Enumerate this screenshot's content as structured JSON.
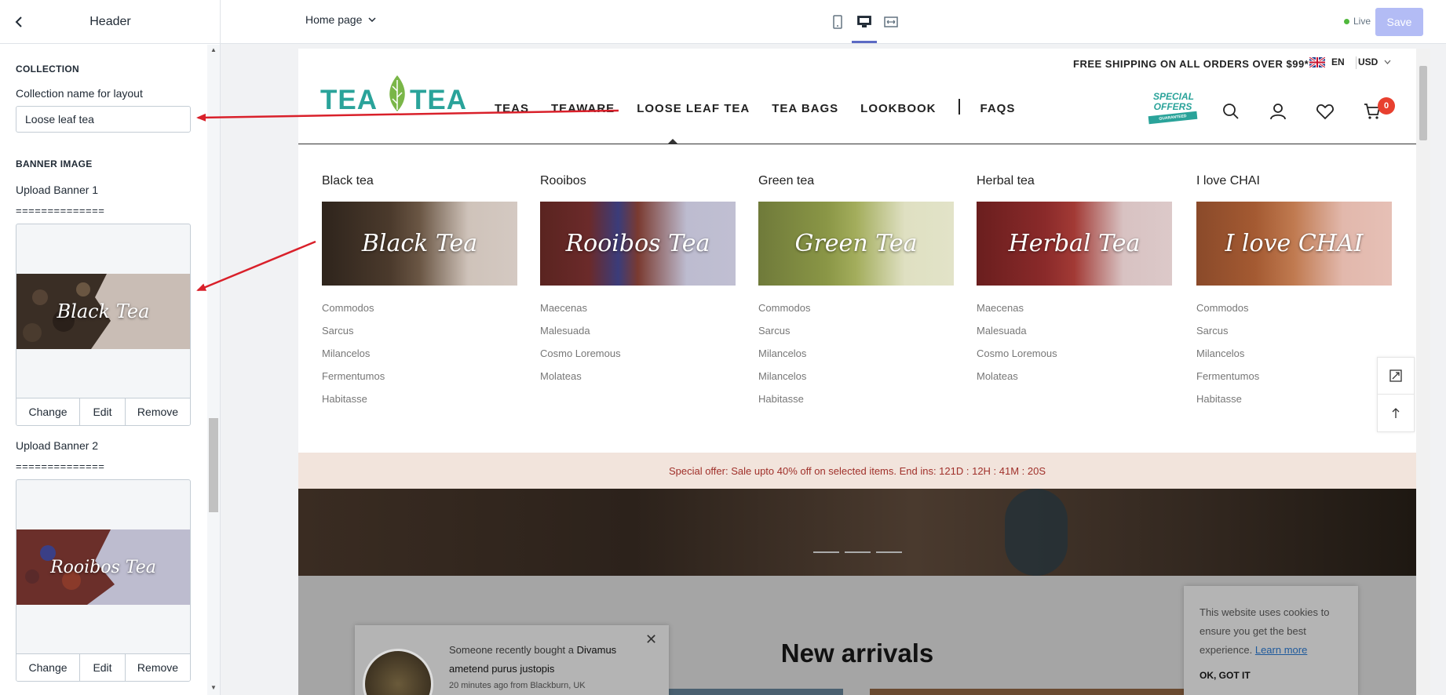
{
  "sidebar": {
    "title": "Header",
    "collection_section": "COLLECTION",
    "collection_label": "Collection name for layout",
    "collection_value": "Loose leaf tea",
    "banner_section": "BANNER IMAGE",
    "upload1_label": "Upload Banner 1",
    "upload2_label": "Upload Banner 2",
    "separator": "==============",
    "upload1_image_text": "Black Tea",
    "upload2_image_text": "Rooibos Tea",
    "actions": {
      "change": "Change",
      "edit": "Edit",
      "remove": "Remove"
    }
  },
  "topbar": {
    "page_select": "Home page",
    "status": "Live",
    "save_label": "Save",
    "accent_color": "#5c6ac4",
    "live_color": "#50b83c"
  },
  "store": {
    "shipping_text": "FREE SHIPPING ON ALL ORDERS OVER $99*",
    "language": "EN",
    "currency": "USD",
    "logo_left": "TEA",
    "logo_right": "TEA",
    "badge_line1": "SPECIAL",
    "badge_line2": "OFFERS",
    "badge_ribbon": "GUARANTEED",
    "nav": [
      "TEAS",
      "TEAWARE",
      "LOOSE LEAF TEA",
      "TEA BAGS",
      "LOOKBOOK",
      "FAQS"
    ],
    "cart_count": "0",
    "mega_menu": [
      {
        "title": "Black tea",
        "image_text": "Black Tea",
        "links": [
          "Commodos",
          "Sarcus",
          "Milancelos",
          "Fermentumos",
          "Habitasse"
        ]
      },
      {
        "title": "Rooibos",
        "image_text": "Rooibos Tea",
        "links": [
          "Maecenas",
          "Malesuada",
          "Cosmo Loremous",
          "Molateas"
        ]
      },
      {
        "title": "Green tea",
        "image_text": "Green Tea",
        "links": [
          "Commodos",
          "Sarcus",
          "Milancelos",
          "Milancelos",
          "Habitasse"
        ]
      },
      {
        "title": "Herbal tea",
        "image_text": "Herbal Tea",
        "links": [
          "Maecenas",
          "Malesuada",
          "Cosmo Loremous",
          "Molateas"
        ]
      },
      {
        "title": "I love CHAI",
        "image_text": "I love CHAI",
        "links": [
          "Commodos",
          "Sarcus",
          "Milancelos",
          "Fermentumos",
          "Habitasse"
        ]
      }
    ],
    "offer_text": "Special offer: Sale upto 40% off on selected items. End ins: 121D : 12H : 41M : 20S",
    "section_title": "New arrivals",
    "notification": {
      "prefix": "Someone recently bought a ",
      "product": "Divamus ametend purus justopis",
      "meta": "20 minutes ago from Blackburn, UK",
      "close": "✕"
    },
    "cookie": {
      "text": "This website uses cookies to ensure you get the best experience.",
      "link": "Learn more",
      "button": "OK, GOT IT"
    },
    "brand_color": "#2aa39a",
    "cart_badge_color": "#e8402f",
    "offer_bg": "#f2e4dc"
  }
}
